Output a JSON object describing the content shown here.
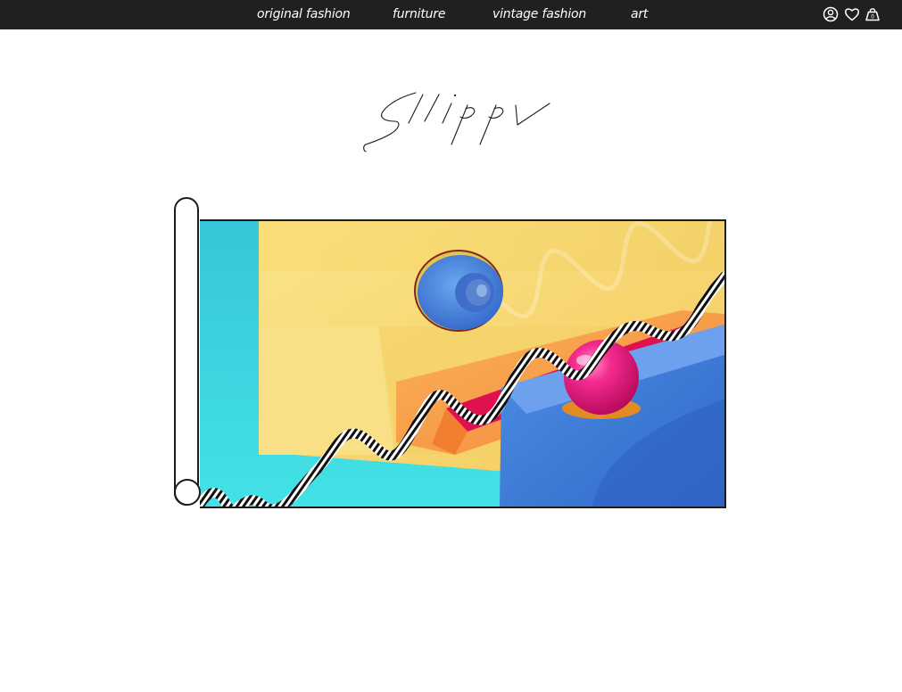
{
  "header": {
    "nav": [
      {
        "label": "original fashion"
      },
      {
        "label": "furniture"
      },
      {
        "label": "vintage fashion"
      },
      {
        "label": "art"
      }
    ],
    "icons": [
      "user-icon",
      "heart-icon",
      "shopping-bag-icon"
    ],
    "background": "#221f1f"
  },
  "brand": {
    "logo": "Slippy"
  },
  "colors": {
    "cyan": "#3ed3de",
    "yellow": "#f7dc6f",
    "orange": "#f79a4a",
    "blue": "#3f7fd9",
    "pink": "#ec1b7c"
  }
}
